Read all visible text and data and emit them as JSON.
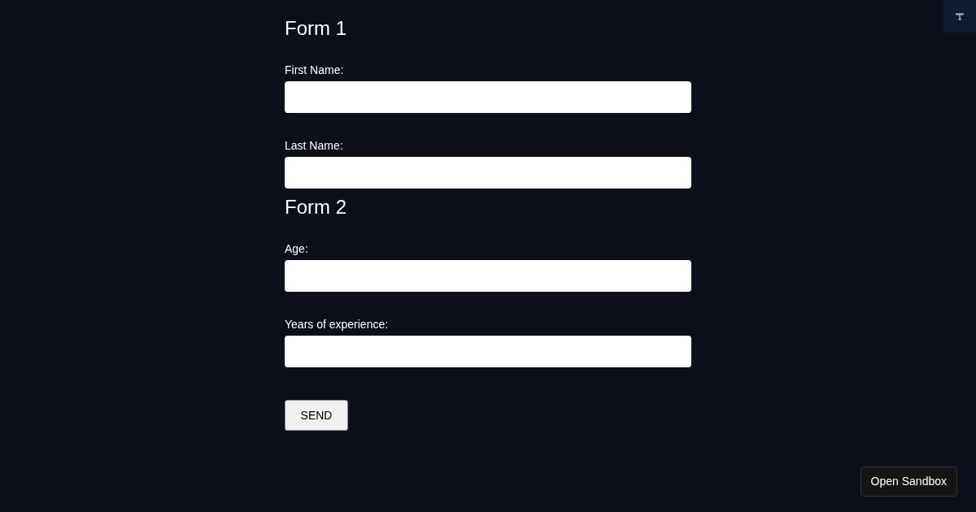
{
  "forms": [
    {
      "title": "Form 1",
      "fields": [
        {
          "label": "First Name:"
        },
        {
          "label": "Last Name:"
        }
      ]
    },
    {
      "title": "Form 2",
      "fields": [
        {
          "label": "Age:"
        },
        {
          "label": "Years of experience:"
        }
      ]
    }
  ],
  "submit": "SEND",
  "sandbox_button": "Open Sandbox"
}
